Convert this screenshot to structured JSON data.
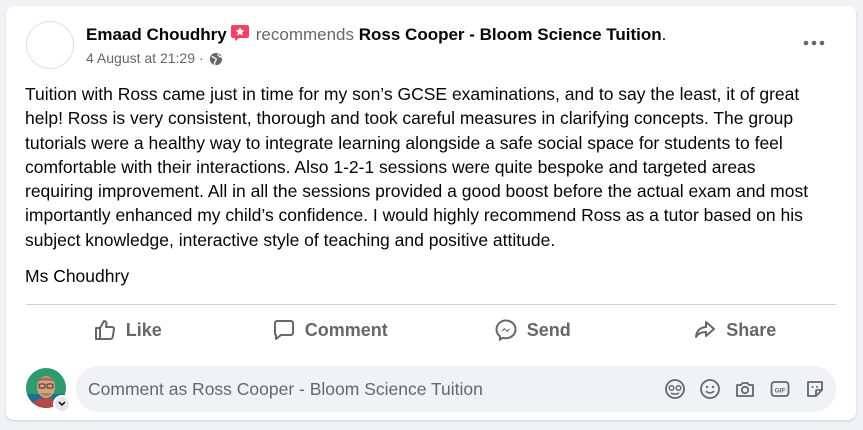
{
  "post": {
    "author": "Emaad Choudhry",
    "action": "recommends",
    "page_name": "Ross Cooper - Bloom Science Tuition",
    "period": ".",
    "timestamp": "4 August at 21:29 ·",
    "body": "Tuition with Ross came just in time for my son’s GCSE examinations, and to say the least, it of great help! Ross is very consistent, thorough and took careful measures in clarifying concepts. The group tutorials were a healthy way to integrate learning alongside a safe social space for students to feel comfortable with their interactions. Also 1-2-1 sessions were quite bespoke and targeted areas requiring improvement. All in all the sessions provided a good boost before the actual exam and most importantly enhanced my child’s confidence. I would highly recommend Ross as a tutor based on his subject knowledge, interactive style of teaching and positive attitude.",
    "signature": "Ms Choudhry"
  },
  "actions": {
    "like": "Like",
    "comment": "Comment",
    "send": "Send",
    "share": "Share"
  },
  "comment_box": {
    "placeholder": "Comment as Ross Cooper - Bloom Science Tuition"
  },
  "icons": {
    "more": "more-horizontal-icon",
    "privacy": "globe-icon",
    "recommend_badge": "recommend-badge-icon",
    "like": "thumbs-up-icon",
    "comment": "speech-bubble-icon",
    "send": "messenger-icon",
    "share": "share-arrow-icon",
    "avatar_sticker": "avatar-sticker-icon",
    "emoji": "smiley-icon",
    "camera": "camera-icon",
    "gif": "gif-icon",
    "sticker": "sticker-icon"
  },
  "colors": {
    "badge": "#f3425f",
    "secondary_text": "#65676b",
    "comment_bg": "#f0f2f5"
  }
}
